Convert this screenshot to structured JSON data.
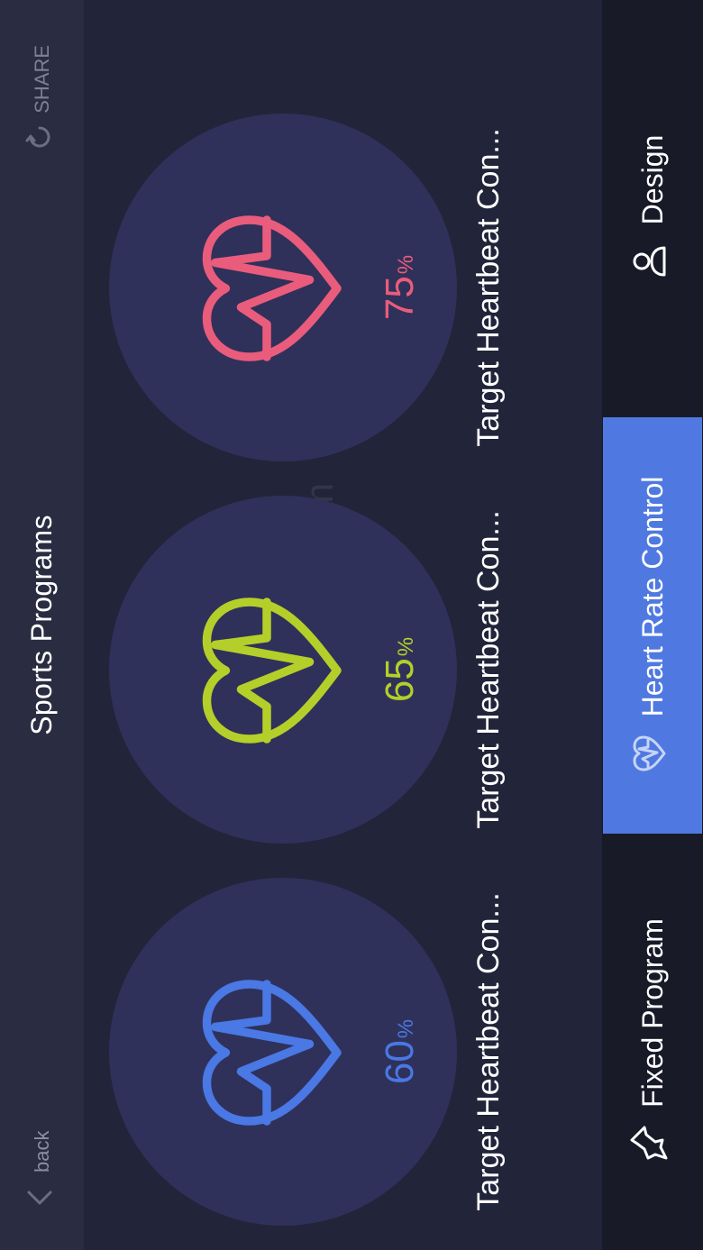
{
  "header": {
    "back_label": "back",
    "title": "Sports Programs",
    "share_label": "SHARE"
  },
  "cards": [
    {
      "percent": "60",
      "unit": "%",
      "label": "Target Heartbeat Con...",
      "color": "#4a78e4"
    },
    {
      "percent": "65",
      "unit": "%",
      "label": "Target Heartbeat Con...",
      "color": "#b4cf2a"
    },
    {
      "percent": "75",
      "unit": "%",
      "label": "Target Heartbeat Con...",
      "color": "#ea5c7c"
    }
  ],
  "tabs": [
    {
      "label": "Fixed Program",
      "icon": "pin-icon",
      "active": false
    },
    {
      "label": "Heart Rate Control",
      "icon": "heart-pulse-icon",
      "active": true
    },
    {
      "label": "Design",
      "icon": "user-icon",
      "active": false
    }
  ],
  "watermark": "UpdateStar.com",
  "colors": {
    "accent": "#4f79e1",
    "background": "#22243a",
    "circle": "#2f315a"
  }
}
